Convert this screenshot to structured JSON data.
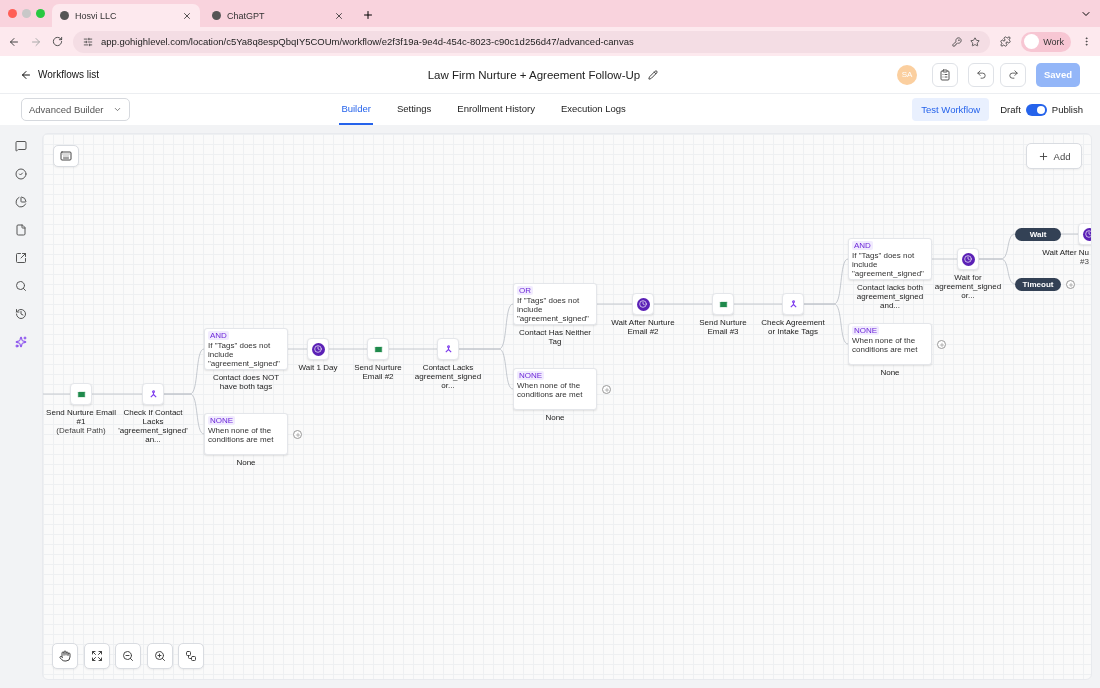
{
  "browser": {
    "tabs": [
      {
        "title": "Hosvi LLC",
        "selected": true
      },
      {
        "title": "ChatGPT",
        "selected": false
      }
    ],
    "url": "app.gohighlevel.com/location/c5Ya8q8espQbqIY5COUm/workflow/e2f3f19a-9e4d-454c-8023-c90c1d256d47/advanced-canvas",
    "profile": "Work"
  },
  "header": {
    "back_label": "Workflows list",
    "title": "Law Firm Nurture + Agreement Follow-Up",
    "avatar": "SA",
    "save_button": "Saved"
  },
  "toolbar": {
    "builder_select": "Advanced Builder",
    "tabs": [
      {
        "label": "Builder",
        "selected": true
      },
      {
        "label": "Settings",
        "selected": false
      },
      {
        "label": "Enrollment History",
        "selected": false
      },
      {
        "label": "Execution Logs",
        "selected": false
      }
    ],
    "test_button": "Test Workflow",
    "draft_label": "Draft",
    "publish": {
      "on": true
    },
    "publish_label": "Publish"
  },
  "canvas": {
    "add_button": "Add",
    "nodes": [
      {
        "kind": "email",
        "label": "Send Nurture Email #1",
        "sublabel": "(Default Path)"
      },
      {
        "kind": "branch",
        "label": "Check If Contact Lacks 'agreement_signed' an..."
      },
      {
        "kind": "condition",
        "badge": "AND",
        "text": "If \"Tags\" does not include \"agreement_signed\"",
        "label": "Contact does NOT have both tags",
        "open_end": false
      },
      {
        "kind": "condition",
        "badge": "NONE",
        "text": "When none of the conditions are met",
        "label": "None",
        "open_end": true
      },
      {
        "kind": "wait",
        "label": "Wait 1 Day"
      },
      {
        "kind": "email",
        "label": "Send Nurture Email #2"
      },
      {
        "kind": "branch",
        "label": "Contact Lacks agreement_signed or..."
      },
      {
        "kind": "condition",
        "badge": "OR",
        "text": "If \"Tags\" does not include \"agreement_signed\"",
        "label": "Contact Has Neither Tag",
        "open_end": false
      },
      {
        "kind": "condition",
        "badge": "NONE",
        "text": "When none of the conditions are met",
        "label": "None",
        "open_end": true
      },
      {
        "kind": "wait",
        "label": "Wait After Nurture Email #2"
      },
      {
        "kind": "email",
        "label": "Send Nurture Email #3"
      },
      {
        "kind": "branch",
        "label": "Check Agreement or Intake Tags"
      },
      {
        "kind": "condition",
        "badge": "AND",
        "text": "If \"Tags\" does not include \"agreement_signed\"",
        "label": "Contact lacks both agreement_signed and...",
        "open_end": false
      },
      {
        "kind": "condition",
        "badge": "NONE",
        "text": "When none of the conditions are met",
        "label": "None",
        "open_end": true
      },
      {
        "kind": "wait",
        "label": "Wait for agreement_signed or..."
      },
      {
        "kind": "pill",
        "label": "Wait",
        "open_end": false
      },
      {
        "kind": "pill",
        "label": "Timeout",
        "open_end": true
      },
      {
        "kind": "wait",
        "label": "Wait After Nu",
        "sublabel": "#3"
      }
    ]
  }
}
